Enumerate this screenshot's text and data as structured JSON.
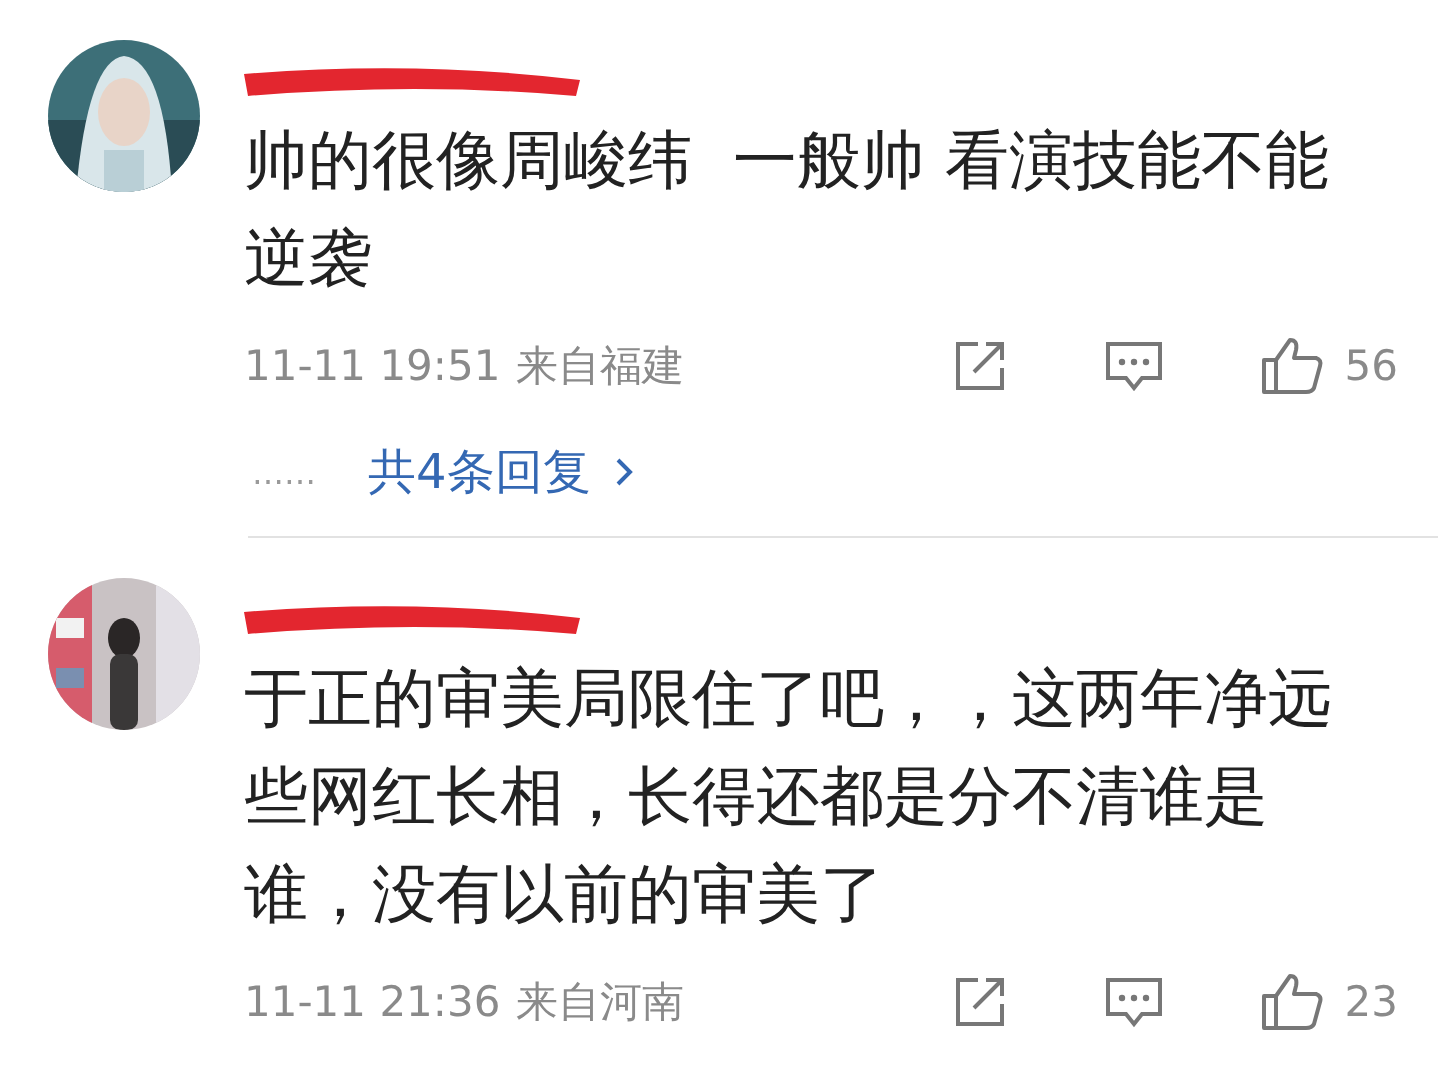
{
  "comments": [
    {
      "text": "帅的很像周峻纬  一般帅 看演技能不能逆袭",
      "time": "11-11 19:51",
      "location": "来自福建",
      "likes": "56",
      "replies": {
        "dots": "……",
        "label": "共4条回复"
      }
    },
    {
      "text": "于正的审美局限住了吧，，这两年净远些网红长相，长得还都是分不清谁是谁，没有以前的审美了",
      "time": "11-11 21:36",
      "location": "来自河南",
      "likes": "23"
    }
  ]
}
